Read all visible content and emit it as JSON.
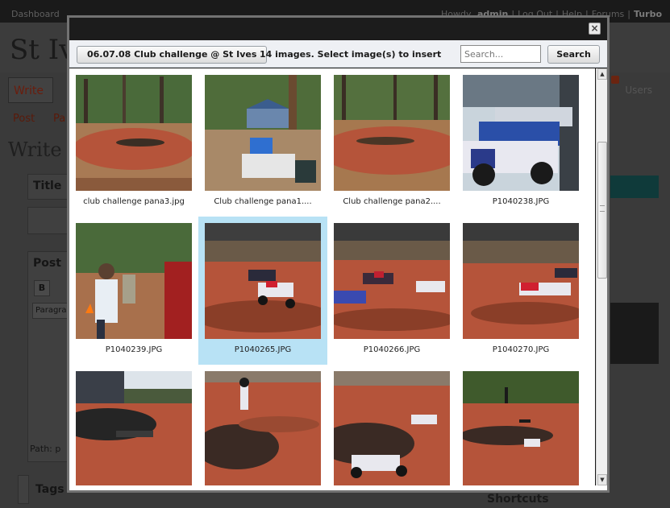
{
  "wp": {
    "dashboard": "Dashboard",
    "howdy": "Howdy,",
    "user": "admin",
    "logout": "Log Out",
    "help": "Help",
    "forums": "Forums",
    "turbo": "Turbo",
    "sep": "|",
    "site_title": "St Iv",
    "tab_write": "Write",
    "tab_users": "Users",
    "sub_post": "Post",
    "sub_page": "Pa",
    "write_heading": "Write",
    "title_label": "Title",
    "post_label": "Post",
    "bold_btn": "B",
    "paragraph_select": "Paragra",
    "path_label": "Path: p",
    "tags_label": "Tags",
    "shortcuts_label": "Shortcuts"
  },
  "modal": {
    "close_glyph": "×",
    "album_button": "06.07.08 Club challenge @ St Ives",
    "status": "14 images. Select image(s) to insert",
    "search_placeholder": "Search...",
    "search_button": "Search",
    "images": [
      {
        "caption": "club challenge pana3.jpg",
        "selected": false
      },
      {
        "caption": "Club challenge pana1....",
        "selected": false
      },
      {
        "caption": "Club challenge pana2....",
        "selected": false
      },
      {
        "caption": "P1040238.JPG",
        "selected": false
      },
      {
        "caption": "P1040239.JPG",
        "selected": false
      },
      {
        "caption": "P1040265.JPG",
        "selected": true
      },
      {
        "caption": "P1040266.JPG",
        "selected": false
      },
      {
        "caption": "P1040270.JPG",
        "selected": false
      },
      {
        "caption": "",
        "selected": false
      },
      {
        "caption": "",
        "selected": false
      },
      {
        "caption": "",
        "selected": false
      },
      {
        "caption": "",
        "selected": false
      }
    ]
  },
  "colors": {
    "selection": "#b8e2f5",
    "dirt": "#b5543a",
    "trees": "#3f5a2c"
  },
  "icons": {
    "close": "close-icon",
    "scroll_up": "arrow-up-icon",
    "scroll_down": "arrow-down-icon"
  }
}
